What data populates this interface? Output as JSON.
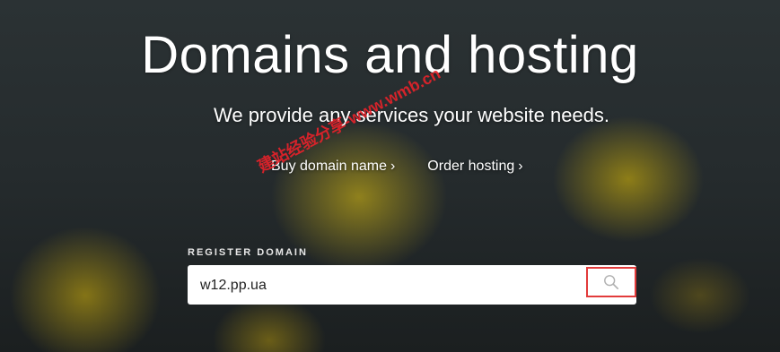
{
  "hero": {
    "title": "Domains and hosting",
    "subtitle": "We provide any services your website needs."
  },
  "links": {
    "buy_domain": "Buy domain name",
    "order_hosting": "Order hosting",
    "chevron": "›"
  },
  "watermark": "建站经验分享-www.wmb.cn",
  "register": {
    "label": "REGISTER DOMAIN",
    "input_value": "w12.pp.ua",
    "search_icon": "search-icon"
  },
  "colors": {
    "highlight_border": "#e23b3b",
    "watermark": "#e8222a"
  }
}
